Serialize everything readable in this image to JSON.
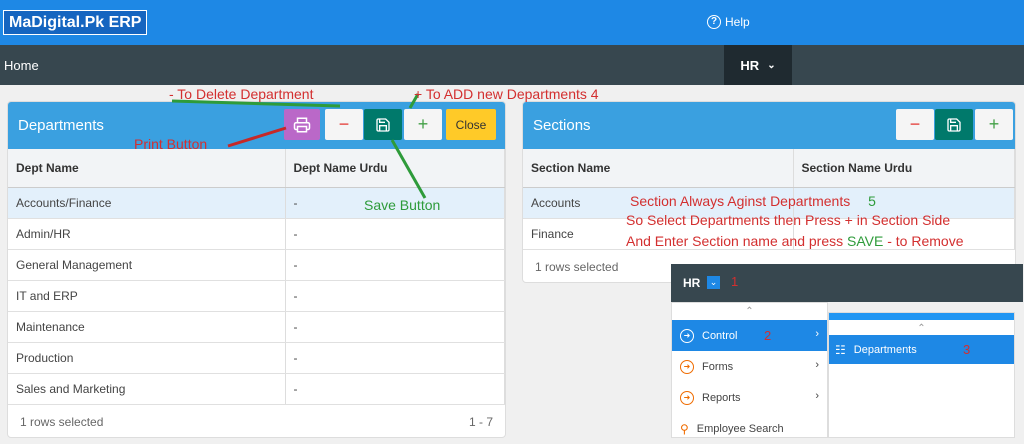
{
  "header": {
    "app_title": "MaDigital.Pk ERP",
    "help_label": "Help"
  },
  "nav": {
    "home": "Home",
    "menu_label": "HR"
  },
  "departments": {
    "title": "Departments",
    "close_label": "Close",
    "columns": [
      "Dept Name",
      "Dept Name Urdu"
    ],
    "rows": [
      [
        "Accounts/Finance",
        "-"
      ],
      [
        "Admin/HR",
        "-"
      ],
      [
        "General Management",
        "-"
      ],
      [
        "IT and ERP",
        "-"
      ],
      [
        "Maintenance",
        "-"
      ],
      [
        "Production",
        "-"
      ],
      [
        "Sales and Marketing",
        "-"
      ]
    ],
    "footer_left": "1 rows selected",
    "footer_right": "1 - 7"
  },
  "sections": {
    "title": "Sections",
    "columns": [
      "Section Name",
      "Section Name Urdu"
    ],
    "rows": [
      [
        "Accounts",
        ""
      ],
      [
        "Finance",
        ""
      ]
    ],
    "footer_left": "1 rows selected"
  },
  "annotations": {
    "delete": "- To Delete Department",
    "add": "+ To ADD new Departments",
    "add_num": "4",
    "print": "Print Button",
    "save": "Save Button",
    "sec1": "Section Always Aginst Departments",
    "sec1_num": "5",
    "sec2": "So Select Departments  then Press + in Section Side",
    "sec3a": "And Enter Section name and press",
    "sec3b": "SAVE",
    "sec3c": "- to Remove",
    "n1": "1",
    "n2": "2",
    "n3": "3"
  },
  "menu": {
    "bar_label": "HR",
    "items": [
      "Control",
      "Forms",
      "Reports",
      "Employee Search"
    ],
    "sub_items": [
      "Departments"
    ]
  },
  "icons": [
    "help-icon",
    "print-icon",
    "minus-icon",
    "save-icon",
    "plus-icon",
    "chevron-down-icon",
    "chevron-right-icon",
    "search-icon",
    "departments-icon"
  ],
  "colors": {
    "header": "#1e88e5",
    "nav": "#37474f",
    "panel_head": "#3aa0e0",
    "save": "#00796b",
    "print": "#ba68c8",
    "close": "#ffca28"
  }
}
